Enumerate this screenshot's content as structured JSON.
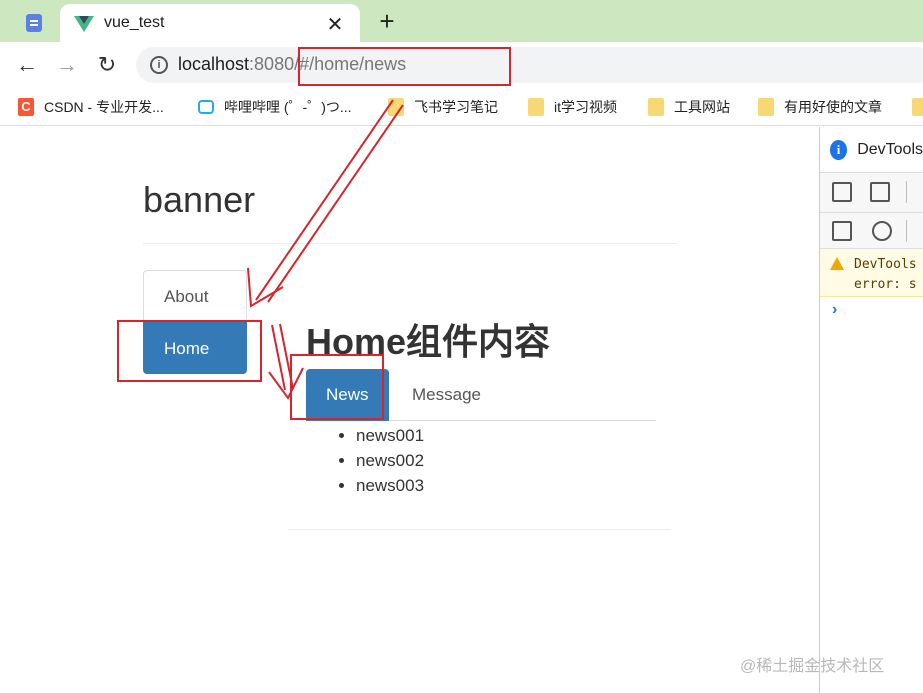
{
  "browser": {
    "tabs": [
      {
        "title": "",
        "icon": "document-icon",
        "active": false
      },
      {
        "title": "vue_test",
        "icon": "vue-logo-icon",
        "active": true
      }
    ],
    "close_glyph": "✕",
    "new_tab_glyph": "+",
    "nav": {
      "back": "←",
      "forward": "→",
      "reload": "↻"
    },
    "address": {
      "host": "localhost",
      "port": ":8080",
      "rest": "/#/home/news"
    },
    "bookmarks": [
      {
        "label": "CSDN - 专业开发...",
        "icon": "csdn-icon"
      },
      {
        "label": "哔哩哔哩 (゜-゜)つ...",
        "icon": "bilibili-icon"
      },
      {
        "label": "飞书学习笔记",
        "icon": "folder-icon"
      },
      {
        "label": "it学习视频",
        "icon": "folder-icon"
      },
      {
        "label": "工具网站",
        "icon": "folder-icon"
      },
      {
        "label": "有用好使的文章",
        "icon": "folder-icon"
      }
    ]
  },
  "page": {
    "banner": "banner",
    "side_nav": [
      {
        "label": "About",
        "active": false
      },
      {
        "label": "Home",
        "active": true
      }
    ],
    "home_heading": "Home组件内容",
    "sub_tabs": [
      {
        "label": "News",
        "active": true
      },
      {
        "label": "Message",
        "active": false
      }
    ],
    "news_items": [
      "news001",
      "news002",
      "news003"
    ]
  },
  "devtools": {
    "title": "DevTools",
    "warning_line1": "DevTools",
    "warning_line2": "error: s",
    "prompt": "›"
  },
  "watermark": "@稀土掘金技术社区",
  "colors": {
    "tab_strip": "#cde8c0",
    "primary": "#337ab7",
    "annotation": "#d6252c"
  }
}
